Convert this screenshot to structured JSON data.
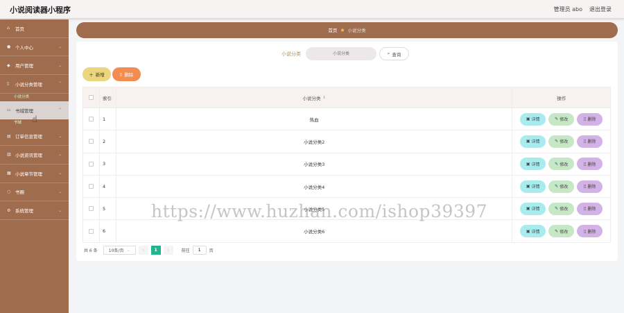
{
  "header": {
    "title": "小说阅读器小程序",
    "admin": "管理员 abo",
    "logout": "退出登录"
  },
  "sidebar": {
    "items": [
      {
        "label": "首页",
        "sub": ""
      },
      {
        "label": "个人中心",
        "sub": ""
      },
      {
        "label": "用户管理",
        "sub": ""
      },
      {
        "label": "小说分类管理",
        "sub": "小说分类"
      },
      {
        "label": "书城管理",
        "sub": "书城"
      },
      {
        "label": "订单信息管理",
        "sub": ""
      },
      {
        "label": "小说资讯管理",
        "sub": ""
      },
      {
        "label": "小说章节管理",
        "sub": ""
      },
      {
        "label": "书圈",
        "sub": ""
      },
      {
        "label": "系统管理",
        "sub": ""
      }
    ]
  },
  "breadcrumb": {
    "home": "首页",
    "current": "小说分类"
  },
  "search": {
    "label": "小说分类",
    "placeholder": "小说分类",
    "button": "查询"
  },
  "actions": {
    "add": "新增",
    "delete": "删除"
  },
  "table": {
    "headers": {
      "index": "索引",
      "name": "小说分类",
      "ops": "操作"
    },
    "ops": {
      "detail": "详情",
      "edit": "修改",
      "remove": "删除"
    },
    "rows": [
      {
        "index": "1",
        "name": "热血"
      },
      {
        "index": "2",
        "name": "小说分类2"
      },
      {
        "index": "3",
        "name": "小说分类3"
      },
      {
        "index": "4",
        "name": "小说分类4"
      },
      {
        "index": "5",
        "name": "小说分类5"
      },
      {
        "index": "6",
        "name": "小说分类6"
      }
    ]
  },
  "pagination": {
    "total": "共 6 条",
    "page_size": "10条/页",
    "current_page": "1",
    "goto_label": "前往",
    "goto_value": "1",
    "page_label": "页"
  },
  "watermark": "https://www.huzhan.com/ishop39397",
  "colors": {
    "sidebar": "#a06c4e",
    "add": "#ebd57e",
    "delete": "#f28c50",
    "detail": "#a9ecf0",
    "edit": "#c6e8c6",
    "remove": "#d3b2e6",
    "page_active": "#25b38f"
  }
}
